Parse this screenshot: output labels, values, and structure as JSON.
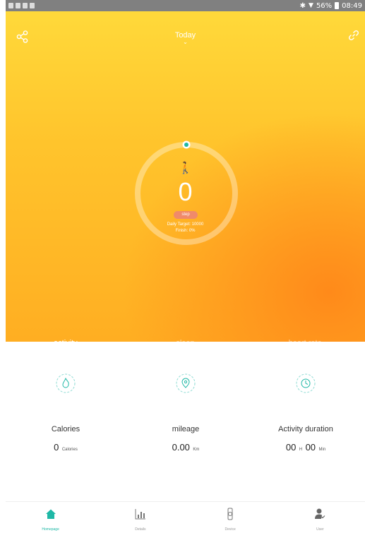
{
  "statusbar": {
    "right_text": "56%",
    "time": "08:49",
    "bluetooth": "✱",
    "wifi": "📶"
  },
  "header": {
    "title": "Today",
    "chevron": "⌄",
    "share_icon": "share-icon",
    "link_icon": "link-icon"
  },
  "ring": {
    "walk_glyph": "🚶",
    "steps": "0",
    "unit": "step",
    "target": "Daily Target: 10000",
    "finish": "Finish: 0%",
    "progress": 0
  },
  "tabs": [
    {
      "label": "activity",
      "active": true
    },
    {
      "label": "sleep",
      "active": false
    },
    {
      "label": "heart rate",
      "active": false
    }
  ],
  "stats": [
    {
      "icon": "flame-icon",
      "label": "Calories",
      "value": "0",
      "unit": "Calories"
    },
    {
      "icon": "location-pin-icon",
      "label": "mileage",
      "value": "0.00",
      "unit": "Km"
    },
    {
      "icon": "clock-icon",
      "label": "Activity duration",
      "value_h": "00",
      "unit_h": "H",
      "value_m": "00",
      "unit_m": "Min"
    }
  ],
  "bottom_nav": [
    {
      "label": "Homepage",
      "icon": "home-icon",
      "active": true
    },
    {
      "label": "Details",
      "icon": "bar-chart-icon",
      "active": false
    },
    {
      "label": "Device",
      "icon": "watch-icon",
      "active": false
    },
    {
      "label": "User",
      "icon": "user-icon",
      "active": false
    }
  ],
  "colors": {
    "accent": "#1fb8a6",
    "hero_top": "#ffd93a",
    "hero_bottom": "#ff8a1a",
    "pill": "#f08a6a"
  }
}
